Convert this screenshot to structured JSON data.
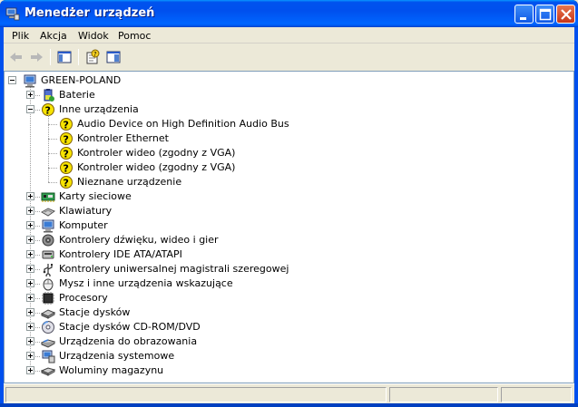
{
  "window": {
    "title": "Menedżer urządzeń"
  },
  "menu": [
    "Plik",
    "Akcja",
    "Widok",
    "Pomoc"
  ],
  "tree": {
    "root": "GREEN-POLAND",
    "categories": [
      {
        "label": "Baterie",
        "icon": "battery-icon",
        "expanded": false
      },
      {
        "label": "Inne urządzenia",
        "icon": "unknown-device-icon",
        "expanded": true,
        "children": [
          "Audio Device on High Definition Audio Bus",
          "Kontroler Ethernet",
          "Kontroler wideo (zgodny z VGA)",
          "Kontroler wideo (zgodny z VGA)",
          "Nieznane urządzenie"
        ]
      },
      {
        "label": "Karty sieciowe",
        "icon": "network-card-icon",
        "expanded": false
      },
      {
        "label": "Klawiatury",
        "icon": "keyboard-icon",
        "expanded": false
      },
      {
        "label": "Komputer",
        "icon": "computer-icon",
        "expanded": false
      },
      {
        "label": "Kontrolery dźwięku, wideo i gier",
        "icon": "speaker-icon",
        "expanded": false
      },
      {
        "label": "Kontrolery IDE ATA/ATAPI",
        "icon": "ide-controller-icon",
        "expanded": false
      },
      {
        "label": "Kontrolery uniwersalnej magistrali szeregowej",
        "icon": "usb-icon",
        "expanded": false
      },
      {
        "label": "Mysz i inne urządzenia wskazujące",
        "icon": "mouse-icon",
        "expanded": false
      },
      {
        "label": "Procesory",
        "icon": "processor-icon",
        "expanded": false
      },
      {
        "label": "Stacje dysków",
        "icon": "disk-drive-icon",
        "expanded": false
      },
      {
        "label": "Stacje dysków CD-ROM/DVD",
        "icon": "cdrom-icon",
        "expanded": false
      },
      {
        "label": "Urządzenia do obrazowania",
        "icon": "scanner-icon",
        "expanded": false
      },
      {
        "label": "Urządzenia systemowe",
        "icon": "system-device-icon",
        "expanded": false
      },
      {
        "label": "Woluminy magazynu",
        "icon": "storage-volume-icon",
        "expanded": false
      }
    ]
  }
}
